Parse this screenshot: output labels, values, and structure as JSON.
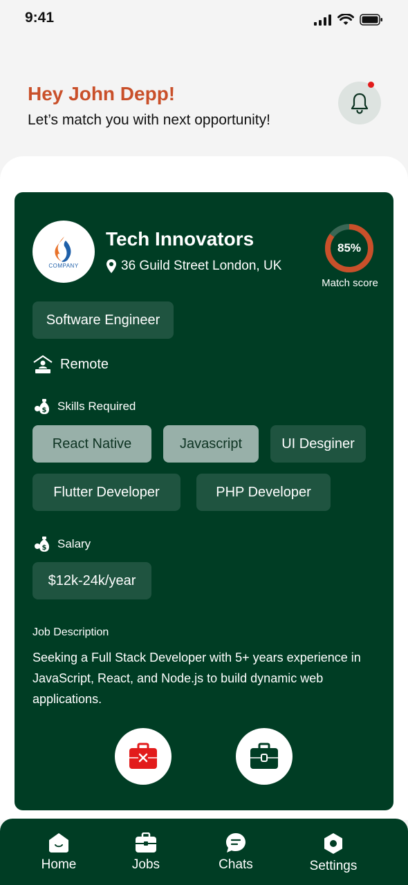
{
  "status_bar": {
    "time": "9:41"
  },
  "header": {
    "greeting": "Hey John Depp!",
    "subtitle": "Let’s match you with next opportunity!",
    "notification_icon": "bell-icon",
    "has_unread": true
  },
  "job": {
    "company_name": "Tech Innovators",
    "company_logo_text": "COMPANY",
    "location": "36 Guild Street London, UK",
    "match_score": "85%",
    "match_score_value": 0.85,
    "match_label": "Match score",
    "role": "Software Engineer",
    "work_mode": "Remote",
    "skills_label": "Skills Required",
    "skills": [
      "React Native",
      "Javascript",
      "UI Desginer",
      "Flutter Developer",
      "PHP Developer"
    ],
    "salary_label": "Salary",
    "salary": "$12k-24k/year",
    "description_label": "Job Description",
    "description": "Seeking a Full Stack Developer with 5+ years experience in JavaScript, React, and Node.js to build dynamic web applications."
  },
  "actions": [
    {
      "name": "reject",
      "icon": "briefcase-x-icon",
      "color": "#e21b1b"
    },
    {
      "name": "apply",
      "icon": "briefcase-icon",
      "color": "#003d24"
    }
  ],
  "colors": {
    "primary": "#003d24",
    "accent": "#c9502a",
    "chip": "#1f5440",
    "chip_selected": "#98b0a9"
  },
  "nav": [
    {
      "label": "Home",
      "icon": "home-icon"
    },
    {
      "label": "Jobs",
      "icon": "briefcase-icon"
    },
    {
      "label": "Chats",
      "icon": "chat-icon"
    },
    {
      "label": "Settings",
      "icon": "gear-icon"
    }
  ]
}
